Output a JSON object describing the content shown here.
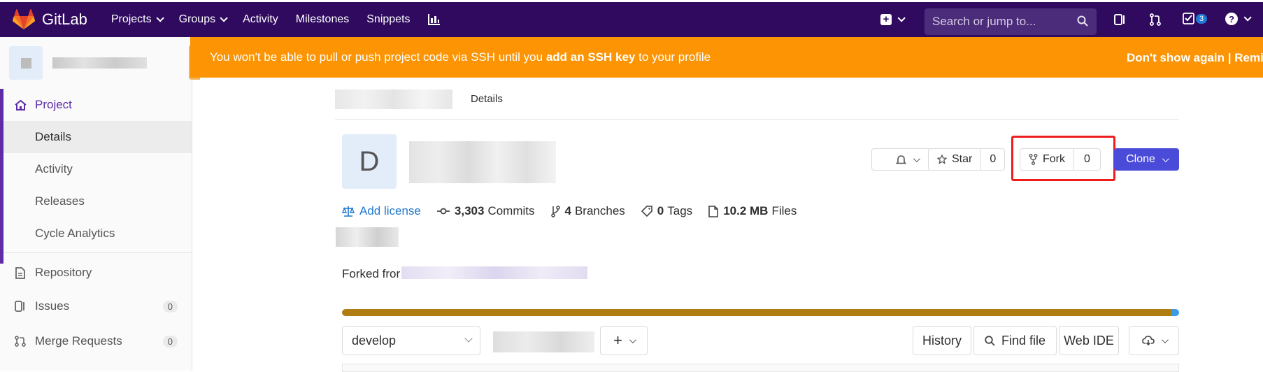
{
  "topbar": {
    "brand": "GitLab",
    "nav": [
      "Projects",
      "Groups",
      "Activity",
      "Milestones",
      "Snippets"
    ],
    "search_placeholder": "Search or jump to...",
    "todo_count": "3"
  },
  "banner": {
    "text_before": "You won't be able to pull or push project code via SSH until you ",
    "link": "add an SSH key",
    "text_after": " to your profile",
    "right": "Don't show again | Remi"
  },
  "sidebar": {
    "project": "Project",
    "project_items": [
      "Details",
      "Activity",
      "Releases",
      "Cycle Analytics"
    ],
    "repository": "Repository",
    "issues": "Issues",
    "issues_count": "0",
    "merge_requests": "Merge Requests",
    "mr_count": "0"
  },
  "breadcrumb": {
    "current": "Details"
  },
  "project": {
    "avatar_letter": "D",
    "star_label": "Star",
    "star_count": "0",
    "fork_label": "Fork",
    "fork_count": "0",
    "clone_label": "Clone"
  },
  "stats": {
    "add_license": "Add license",
    "commits_num": "3,303",
    "commits_label": "Commits",
    "branches_num": "4",
    "branches_label": "Branches",
    "tags_num": "0",
    "tags_label": "Tags",
    "files_num": "10.2 MB",
    "files_label": "Files"
  },
  "forked_from": "Forked fror",
  "language_bar": {
    "primary_fraction": 0.991,
    "colors": [
      "#b07d12",
      "#3b9be8"
    ]
  },
  "toolbar": {
    "branch": "develop",
    "plus": "+",
    "history": "History",
    "find_file": "Find file",
    "web_ide": "Web IDE"
  }
}
